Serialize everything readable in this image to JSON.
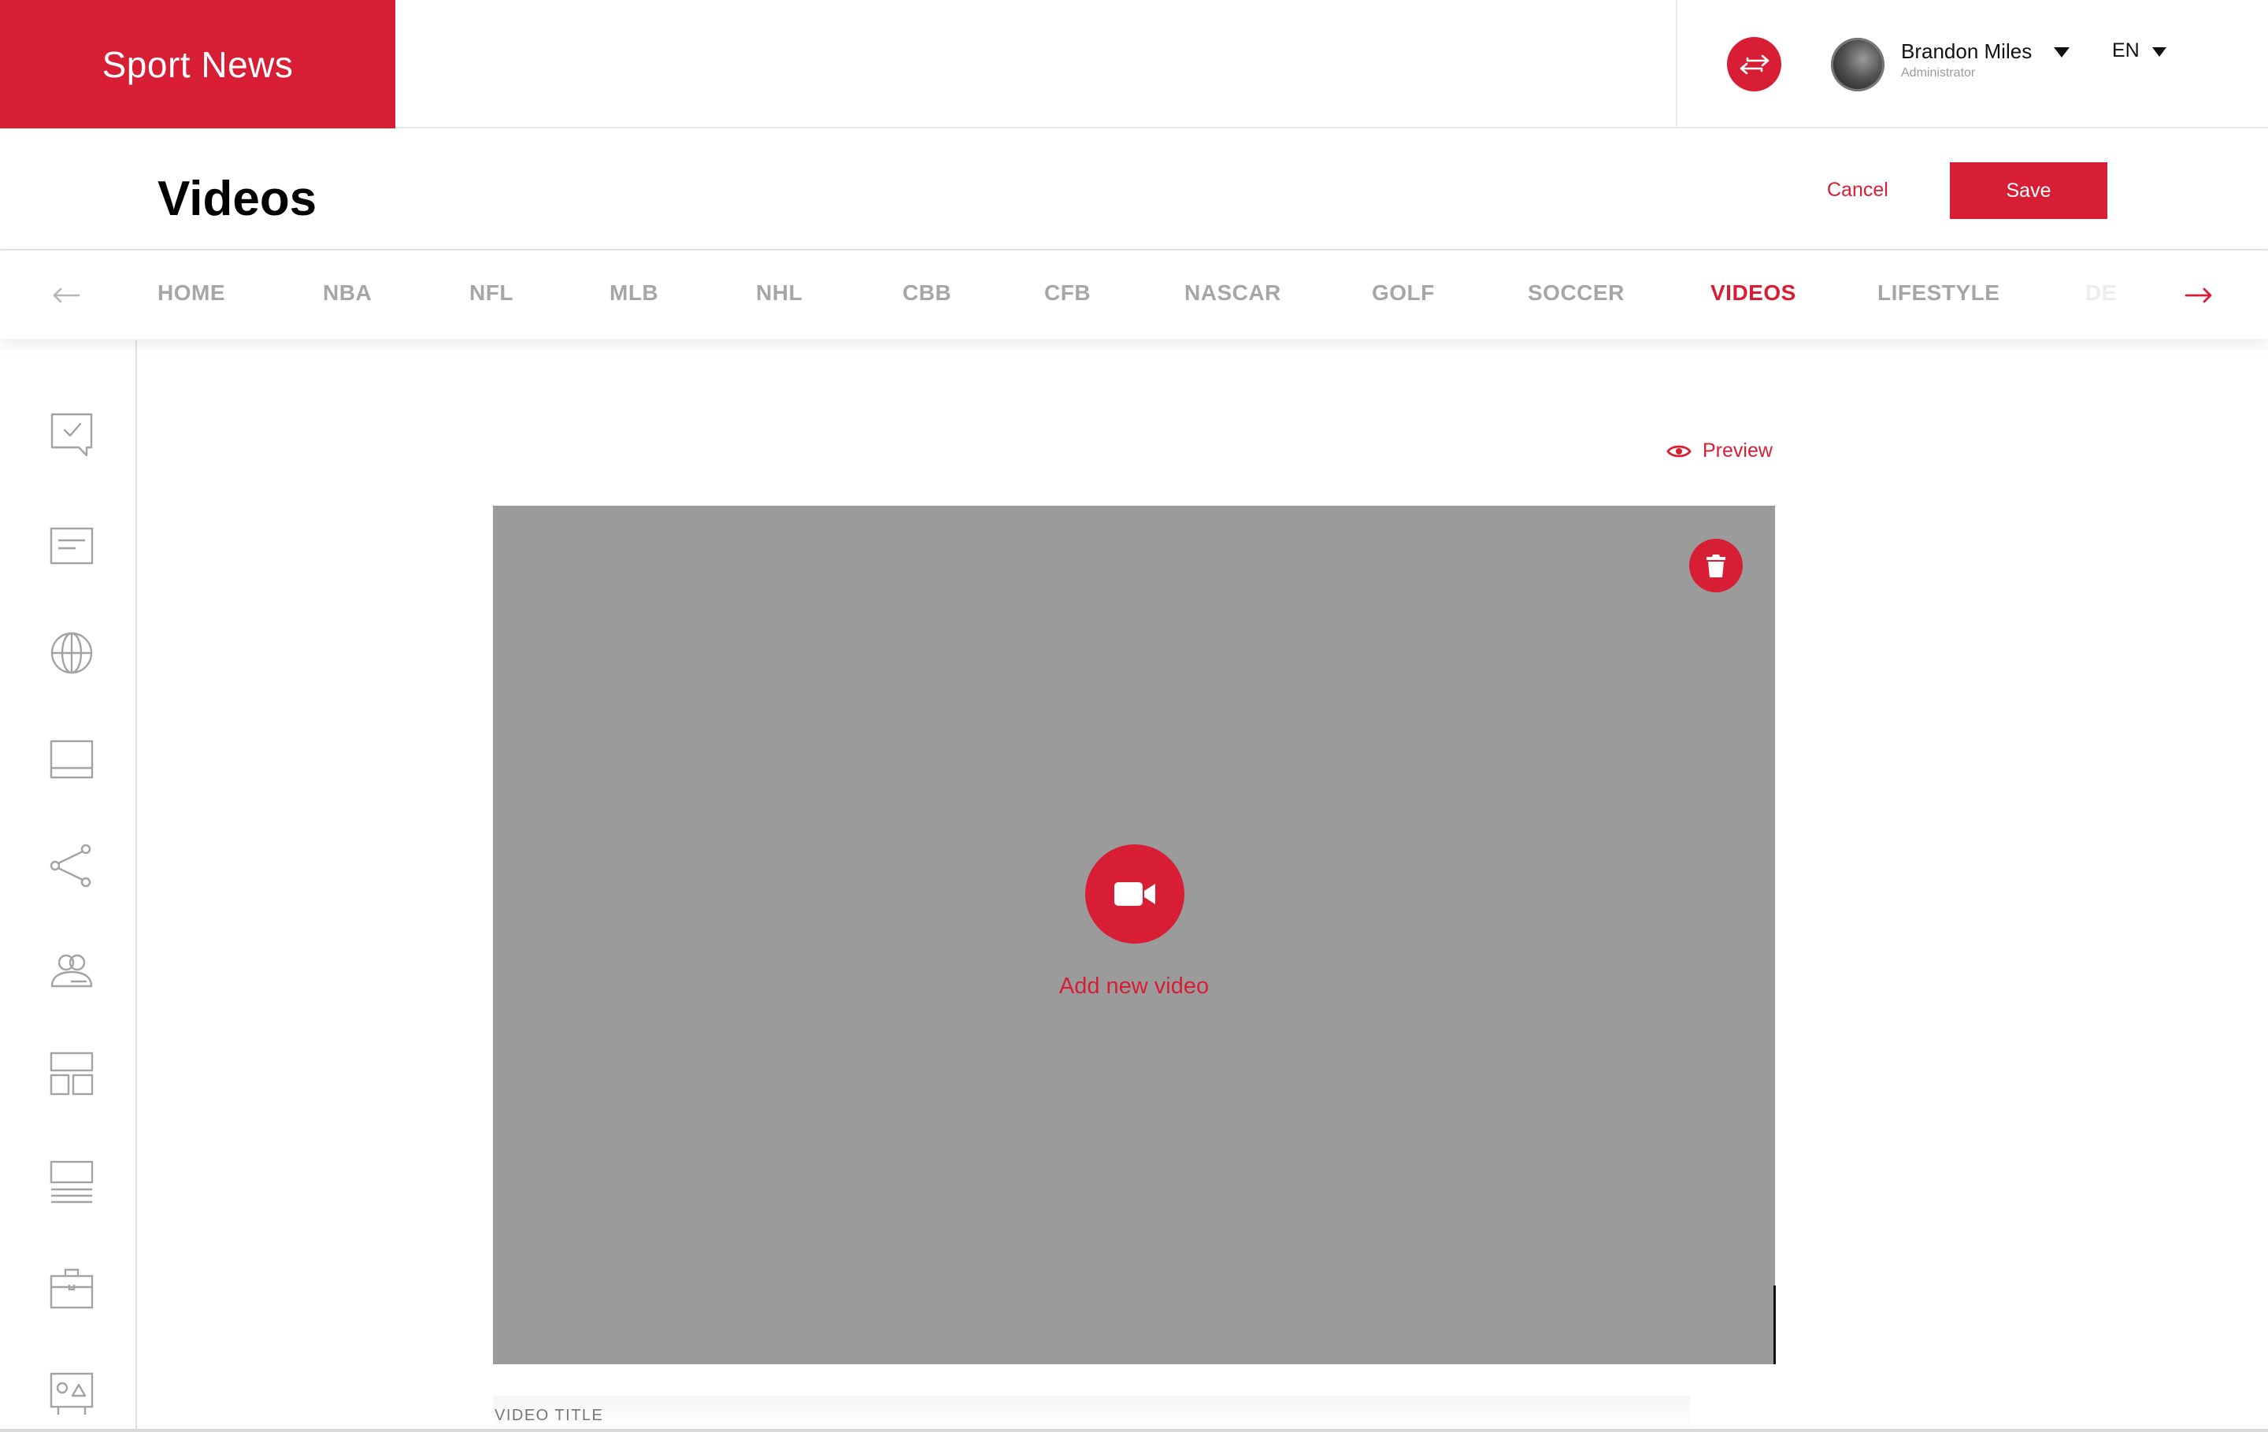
{
  "header": {
    "brand": "Sport News",
    "user": {
      "name": "Brandon Miles",
      "role": "Administrator"
    },
    "language": "EN"
  },
  "page": {
    "title": "Videos",
    "cancel_label": "Cancel",
    "save_label": "Save"
  },
  "nav": {
    "items": [
      "HOME",
      "NBA",
      "NFL",
      "MLB",
      "NHL",
      "CBB",
      "CFB",
      "NASCAR",
      "GOLF",
      "SOCCER",
      "VIDEOS",
      "LIFESTYLE",
      "DE"
    ],
    "active": "VIDEOS"
  },
  "sidebar": {
    "icons": [
      "chat-check-icon",
      "article-icon",
      "globe-icon",
      "layout-bottom-icon",
      "share-icon",
      "users-icon",
      "layout-grid-icon",
      "list-lines-icon",
      "briefcase-icon",
      "gallery-icon"
    ]
  },
  "content": {
    "preview_label": "Preview",
    "add_video_label": "Add new video",
    "video_title_label": "VIDEO TITLE"
  },
  "colors": {
    "accent": "#d81e34",
    "placeholder": "#9b9b9b",
    "nav_inactive": "#a6a6a6"
  }
}
